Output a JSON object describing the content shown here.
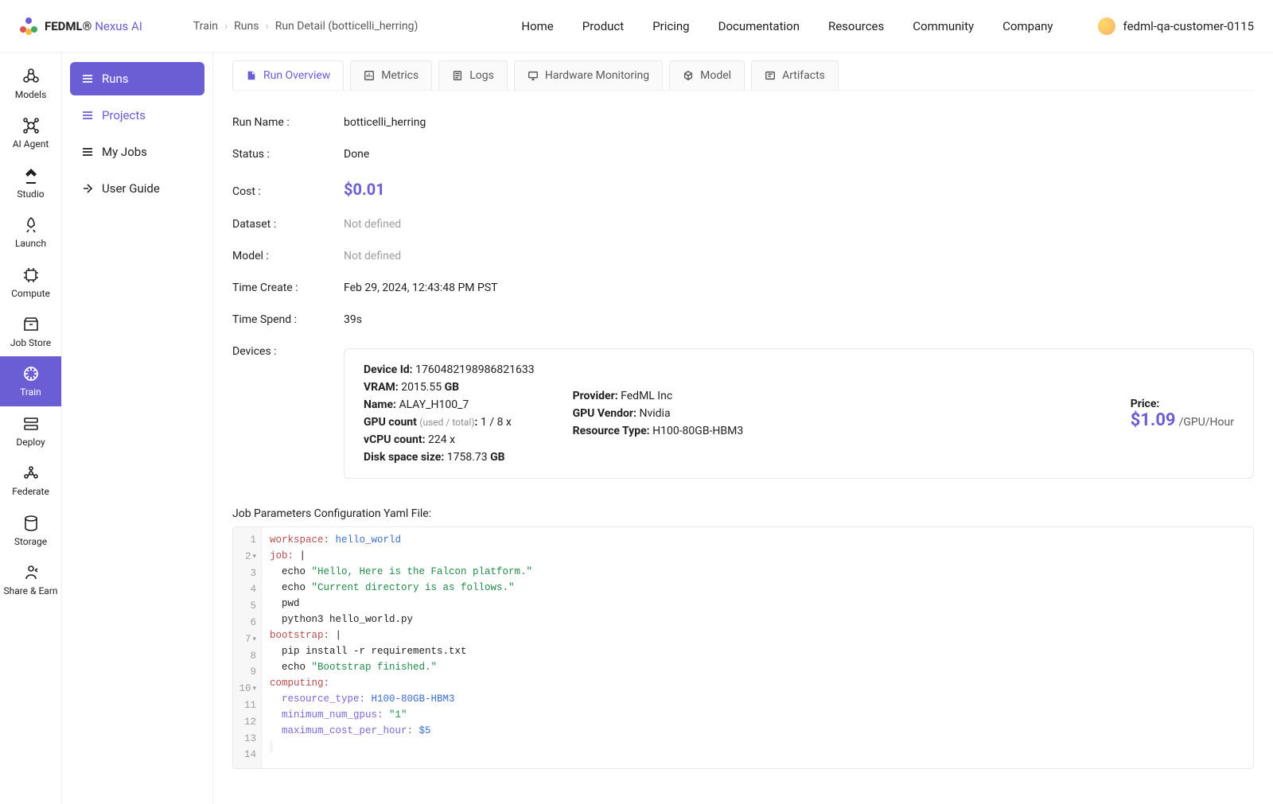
{
  "brand": {
    "name": "FEDML®",
    "sub": "Nexus AI"
  },
  "breadcrumb": {
    "a": "Train",
    "b": "Runs",
    "c": "Run Detail (botticelli_herring)"
  },
  "topnav": {
    "home": "Home",
    "product": "Product",
    "pricing": "Pricing",
    "documentation": "Documentation",
    "resources": "Resources",
    "community": "Community",
    "company": "Company"
  },
  "user": {
    "name": "fedml-qa-customer-0115"
  },
  "rail": {
    "models": "Models",
    "aiagent": "AI Agent",
    "studio": "Studio",
    "launch": "Launch",
    "compute": "Compute",
    "jobstore": "Job Store",
    "train": "Train",
    "deploy": "Deploy",
    "federate": "Federate",
    "storage": "Storage",
    "share": "Share & Earn"
  },
  "subnav": {
    "runs": "Runs",
    "projects": "Projects",
    "myjobs": "My Jobs",
    "userguide": "User Guide"
  },
  "tabs": {
    "overview": "Run Overview",
    "metrics": "Metrics",
    "logs": "Logs",
    "hardware": "Hardware Monitoring",
    "model": "Model",
    "artifacts": "Artifacts"
  },
  "kv": {
    "run_name": {
      "k": "Run Name :",
      "v": "botticelli_herring"
    },
    "status": {
      "k": "Status :",
      "v": "Done"
    },
    "cost": {
      "k": "Cost :",
      "v": "$0.01"
    },
    "dataset": {
      "k": "Dataset :",
      "v": "Not defined"
    },
    "model": {
      "k": "Model :",
      "v": "Not defined"
    },
    "created": {
      "k": "Time Create :",
      "v": "Feb 29, 2024, 12:43:48 PM PST"
    },
    "spend": {
      "k": "Time Spend :",
      "v": "39s"
    },
    "devices": {
      "k": "Devices :"
    }
  },
  "device": {
    "id_label": "Device Id:",
    "id": "1760482198986821633",
    "vram_label": "VRAM:",
    "vram": "2015.55",
    "vram_unit": "GB",
    "name_label": "Name:",
    "name": "ALAY_H100_7",
    "gpu_label": "GPU count",
    "gpu_sub": "(used / total)",
    "gpu_val": "1 / 8 x",
    "vcpu_label": "vCPU count:",
    "vcpu": "224 x",
    "disk_label": "Disk space size:",
    "disk": "1758.73",
    "disk_unit": "GB",
    "provider_label": "Provider:",
    "provider": "FedML Inc",
    "vendor_label": "GPU Vendor:",
    "vendor": "Nvidia",
    "rtype_label": "Resource Type:",
    "rtype": "H100-80GB-HBM3",
    "price_label": "Price:",
    "price": "$1.09",
    "price_unit": "/GPU/Hour"
  },
  "yaml": {
    "label": "Job Parameters Configuration Yaml File:",
    "lines_count": 14,
    "l1_key": "workspace:",
    "l1_val": " hello_world",
    "l2_key": "job:",
    "l2_val": " |",
    "l3": "  echo ",
    "l3_str": "\"Hello, Here is the Falcon platform.\"",
    "l4": "  echo ",
    "l4_str": "\"Current directory is as follows.\"",
    "l5": "  pwd",
    "l6": "  python3 hello_world.py",
    "l7_key": "bootstrap:",
    "l7_val": " |",
    "l8": "  pip install -r requirements.txt",
    "l9": "  echo ",
    "l9_str": "\"Bootstrap finished.\"",
    "l10_key": "computing:",
    "l11_sub": "  resource_type:",
    "l11_val": " H100-80GB-HBM3",
    "l12_sub": "  minimum_num_gpus:",
    "l12_val": " \"1\"",
    "l13_sub": "  maximum_cost_per_hour:",
    "l13_val": " $5"
  }
}
